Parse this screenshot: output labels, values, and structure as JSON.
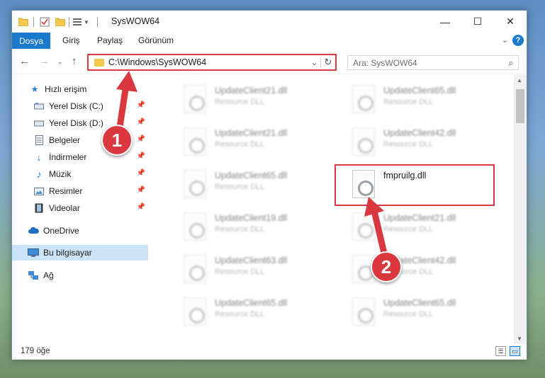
{
  "window": {
    "title": "SysWOW64",
    "minimize_glyph": "—",
    "maximize_glyph": "☐",
    "close_glyph": "✕"
  },
  "ribbon": {
    "tabs": [
      {
        "label": "Dosya"
      },
      {
        "label": "Giriş"
      },
      {
        "label": "Paylaş"
      },
      {
        "label": "Görünüm"
      }
    ],
    "help_glyph": "?"
  },
  "navbar": {
    "address": "C:\\Windows\\SysWOW64",
    "search_placeholder": "Ara: SysWOW64"
  },
  "sidebar": {
    "items": [
      {
        "label": "Hızlı erişim",
        "icon": "star-icon"
      },
      {
        "label": "Yerel Disk (C:)",
        "icon": "drive-icon",
        "pinned": true
      },
      {
        "label": "Yerel Disk (D:)",
        "icon": "drive-icon",
        "pinned": true
      },
      {
        "label": "Belgeler",
        "icon": "documents-icon",
        "pinned": true
      },
      {
        "label": "İndirmeler",
        "icon": "download-icon",
        "pinned": true
      },
      {
        "label": "Müzik",
        "icon": "music-icon",
        "pinned": true
      },
      {
        "label": "Resimler",
        "icon": "pictures-icon",
        "pinned": true
      },
      {
        "label": "Videolar",
        "icon": "videos-icon",
        "pinned": true
      },
      {
        "label": "OneDrive",
        "icon": "cloud-icon"
      },
      {
        "label": "Bu bilgisayar",
        "icon": "computer-icon",
        "selected": true
      },
      {
        "label": "Ağ",
        "icon": "network-icon"
      }
    ]
  },
  "files": [
    {
      "name": "UpdateClient21.dll",
      "type": "Resource DLL",
      "blurred": true
    },
    {
      "name": "UpdateClient65.dll",
      "type": "Resource DLL",
      "blurred": true
    },
    {
      "name": "UpdateClient21.dll",
      "type": "Resource DLL",
      "blurred": true
    },
    {
      "name": "UpdateClient42.dll",
      "type": "Resource DLL",
      "blurred": true
    },
    {
      "name": "UpdateClient65.dll",
      "type": "Resource DLL",
      "blurred": true
    },
    {
      "name": "fmpruilg.dll",
      "type": "",
      "blurred": false
    },
    {
      "name": "UpdateClient19.dll",
      "type": "Resource DLL",
      "blurred": true
    },
    {
      "name": "UpdateClient21.dll",
      "type": "Resource DLL",
      "blurred": true
    },
    {
      "name": "UpdateClient63.dll",
      "type": "Resource DLL",
      "blurred": true
    },
    {
      "name": "UpdateClient42.dll",
      "type": "Resource DLL",
      "blurred": true
    },
    {
      "name": "UpdateClient65.dll",
      "type": "Resource DLL",
      "blurred": true
    },
    {
      "name": "UpdateClient65.dll",
      "type": "Resource DLL",
      "blurred": true
    }
  ],
  "status": {
    "item_count": "179 öğe"
  },
  "annotations": {
    "step1": "1",
    "step2": "2",
    "color": "#d9393e"
  }
}
